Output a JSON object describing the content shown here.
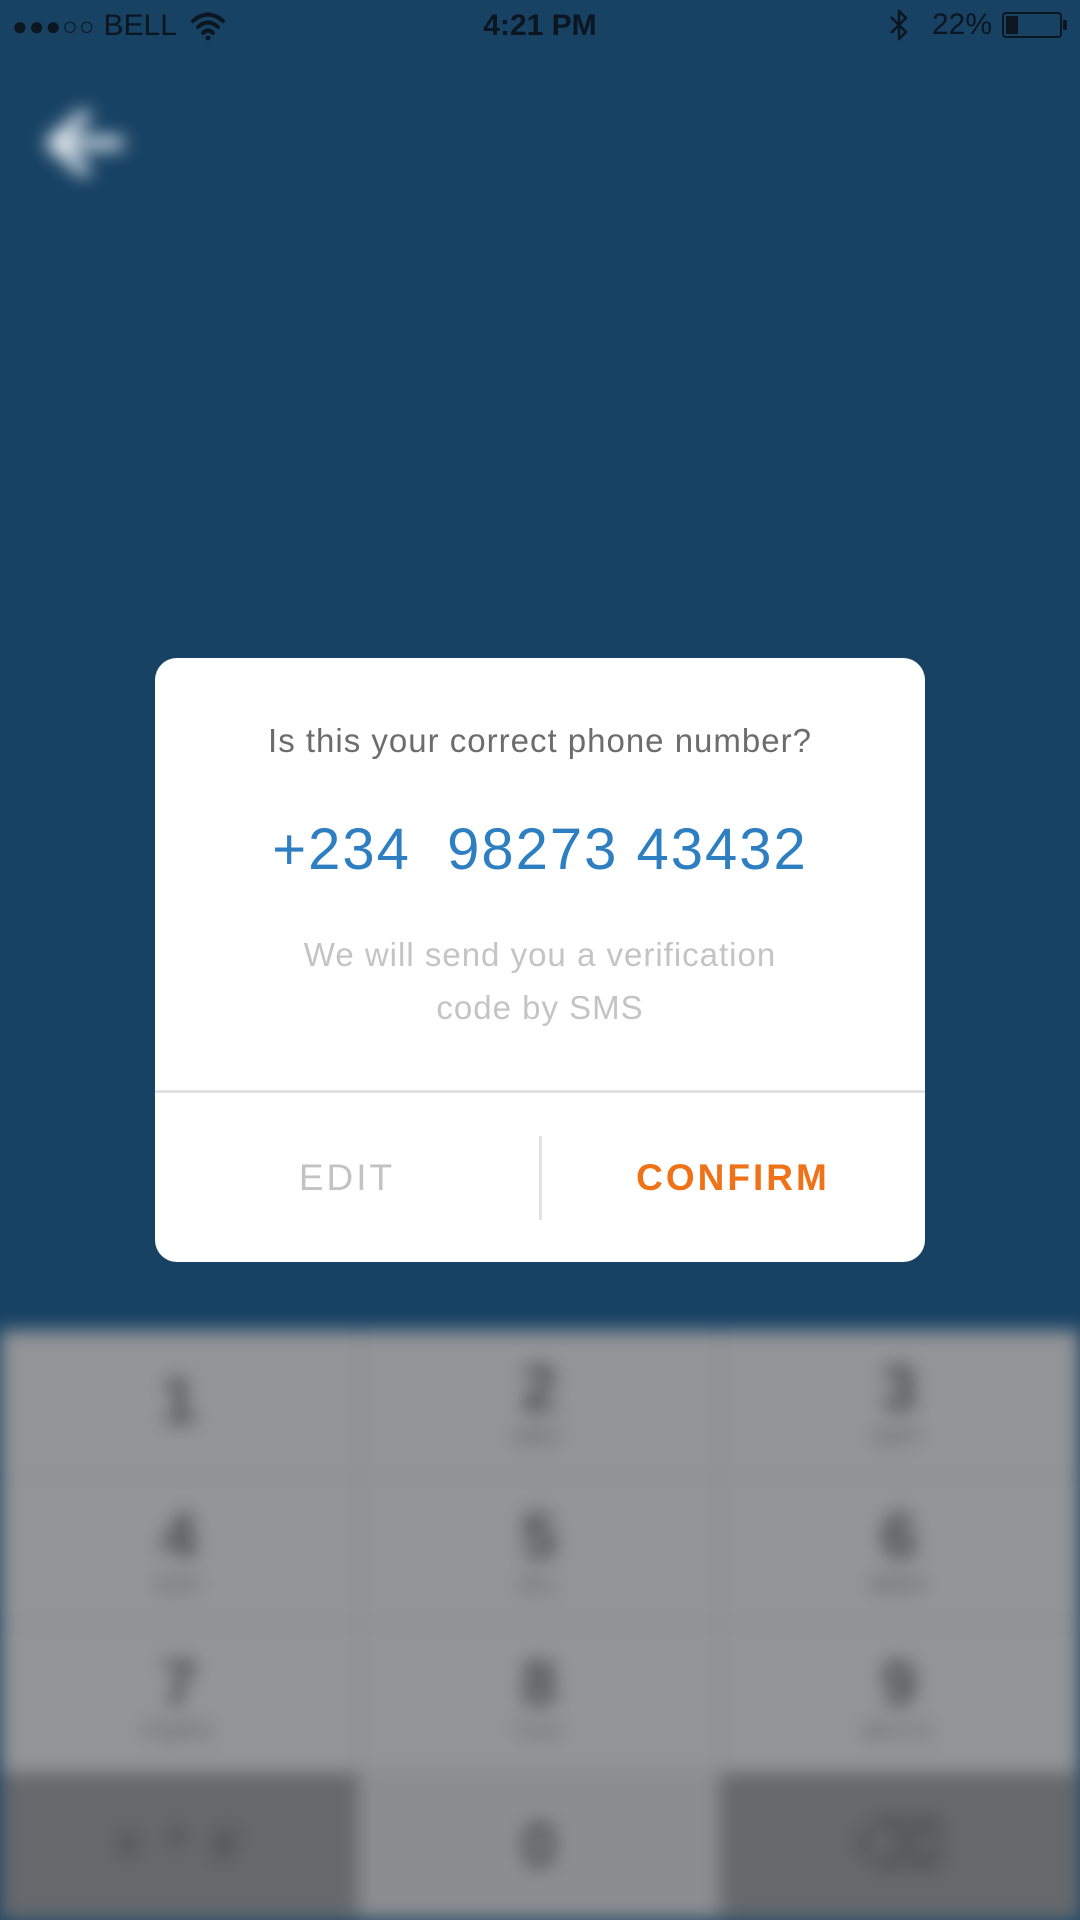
{
  "status_bar": {
    "signal": "●●●○○",
    "carrier": "BELL",
    "time": "4:21 PM",
    "battery_text": "22%",
    "battery_level": 0.22
  },
  "keypad": {
    "keys": [
      {
        "digit": "1",
        "letters": ""
      },
      {
        "digit": "2",
        "letters": "ABC"
      },
      {
        "digit": "3",
        "letters": "DEF"
      },
      {
        "digit": "4",
        "letters": "GHI"
      },
      {
        "digit": "5",
        "letters": "JKL"
      },
      {
        "digit": "6",
        "letters": "MNO"
      },
      {
        "digit": "7",
        "letters": "PQRS"
      },
      {
        "digit": "8",
        "letters": "TUV"
      },
      {
        "digit": "9",
        "letters": "WXYZ"
      },
      {
        "digit": "+ * #",
        "letters": ""
      },
      {
        "digit": "0",
        "letters": ""
      },
      {
        "digit": "⌫",
        "letters": ""
      }
    ]
  },
  "dialog": {
    "question": "Is this your correct phone number?",
    "phone": "+234  98273 43432",
    "info": "We will send you a verification code by SMS",
    "edit_label": "EDIT",
    "confirm_label": "CONFIRM"
  },
  "colors": {
    "background": "#184264",
    "phone": "#2d7fc1",
    "confirm": "#ef7219",
    "edit": "#c2c2c2"
  }
}
